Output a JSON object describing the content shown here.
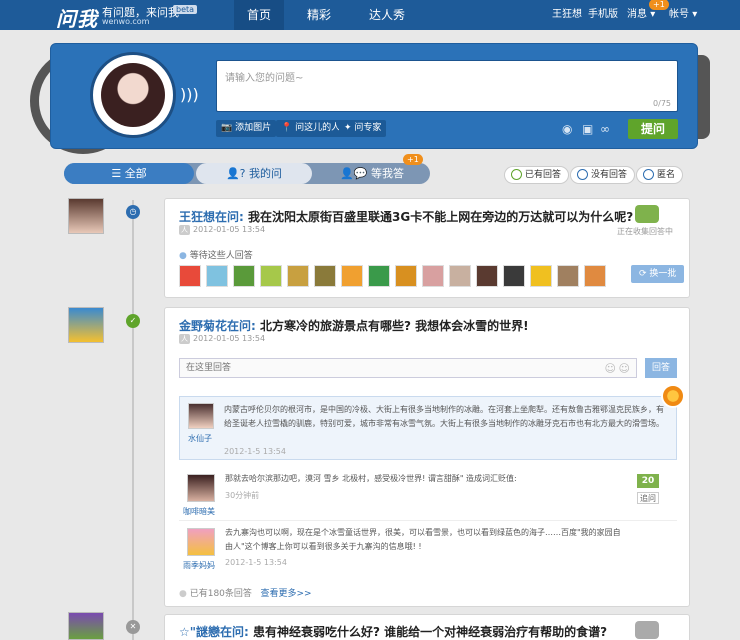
{
  "nav": {
    "logo": "问我",
    "slogan": "有问题，来问我",
    "slogan_url": "wenwo.com",
    "beta": "beta",
    "tabs": [
      {
        "label": "首页"
      },
      {
        "label": "精彩"
      },
      {
        "label": "达人秀"
      }
    ],
    "user": "王狂想",
    "mobile": "手机版",
    "notice": "消息",
    "notice_count": "+1",
    "account": "帐号"
  },
  "ask": {
    "placeholder": "请输入您的问题~",
    "counter": "0/75",
    "tools": [
      "添加图片",
      "问这儿的人",
      "问专家"
    ],
    "submit": "提问"
  },
  "filter": {
    "all": "全部",
    "mine": "我的问",
    "waiting": "等我答",
    "waiting_count": "+1",
    "answered": "已有回答",
    "unanswered": "没有回答",
    "anonymous": "匿名"
  },
  "q1": {
    "asker": "王狂想在问:",
    "title": "我在沈阳太原街百盛里联通3G卡不能上网在旁边的万达就可以为什么呢?",
    "tag": "人",
    "time": "2012-01-05 13:54",
    "status": "正在收集回答中",
    "waiting_label": "等待这些人回答",
    "swap": "换一批"
  },
  "q2": {
    "asker": "金野菊花在问:",
    "title": "北方寒冷的旅游景点有哪些? 我想体会冰雪的世界!",
    "tag": "人",
    "time": "2012-01-05 13:54",
    "reply_placeholder": "在这里回答",
    "reply_btn": "回答",
    "best": {
      "name": "水仙子",
      "text": "内蒙古呼伦贝尔的根河市，是中国的冷极、大街上有很多当地制作的冰雕。在河套上坐爬犁。还有敖鲁古雅鄂温克民族乡，有给圣诞老人拉雪橇的驯鹿，特别可爱，城市非常有冰雪气氛。大街上有很多当地制作的冰雕牙克石市也有北方最大的滑雪场。",
      "time": "2012-1-5  13:54"
    },
    "answers": [
      {
        "name": "咖啡暗美",
        "text": "那就去哈尔滨那边吧，漠河 雪乡 北极村，感受极冷世界! 谓言甜酥\" 造成词汇贬值:",
        "time": "30分钟前",
        "votes": "20",
        "vote_label": "追问"
      },
      {
        "name": "雨季妈妈",
        "text": "去九寨沟也可以啊，现在是个冰雪童话世界，很美，可以看雪景，也可以看到绿蓝色的海子……百度\"我的家园自由人\"这个博客上你可以看到很多关于九寨沟的信息哦! !",
        "time": "2012-1-5  13:54"
      }
    ],
    "total": "已有180条回答",
    "more": "查看更多>>"
  },
  "q3": {
    "asker": "☆\"謎戀在问:",
    "title": "患有神经衰弱吃什么好? 谁能给一个对神经衰弱治疗有帮助的食谱?"
  }
}
